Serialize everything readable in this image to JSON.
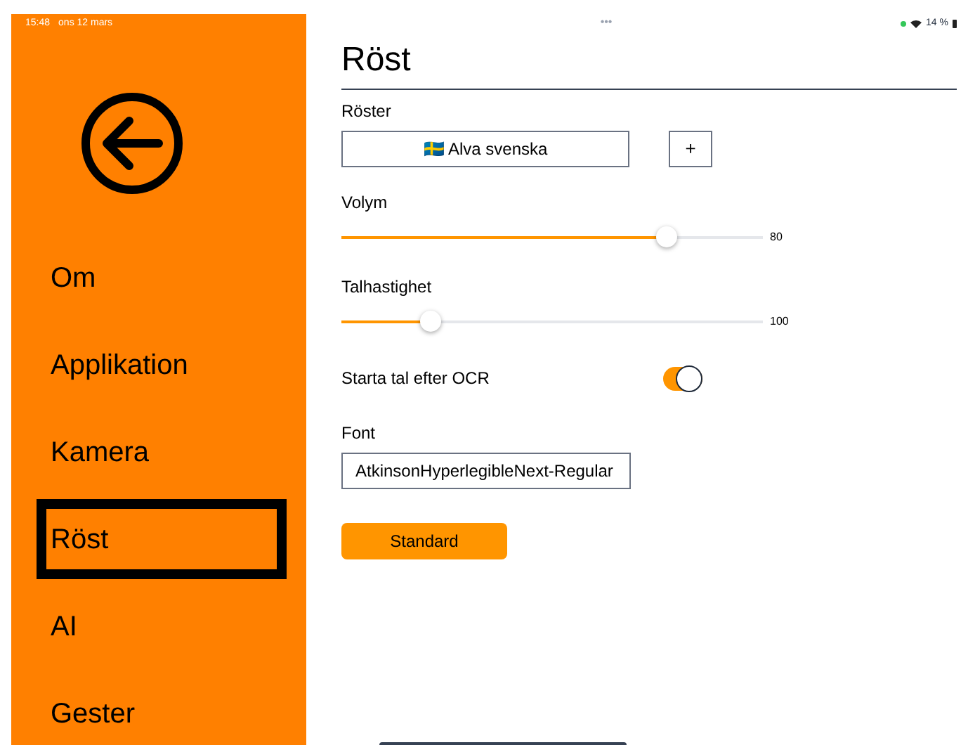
{
  "status_bar": {
    "time": "15:48",
    "date": "ons 12 mars",
    "dots": "•••",
    "battery": "14 %"
  },
  "sidebar": {
    "items": [
      {
        "label": "Om",
        "selected": false
      },
      {
        "label": "Applikation",
        "selected": false
      },
      {
        "label": "Kamera",
        "selected": false
      },
      {
        "label": "Röst",
        "selected": true
      },
      {
        "label": "AI",
        "selected": false
      },
      {
        "label": "Gester",
        "selected": false
      }
    ]
  },
  "page": {
    "title": "Röst",
    "voices": {
      "label": "Röster",
      "value": "🇸🇪 Alva svenska",
      "add": "+"
    },
    "sliders": [
      {
        "label": "Volym",
        "level": 0.77,
        "reading": "80"
      },
      {
        "label": "Talhastighet",
        "level": 0.21,
        "reading": "100"
      }
    ],
    "toggle": {
      "label": "Starta tal efter OCR",
      "on": true
    },
    "font": {
      "label": "Font",
      "value": "AtkinsonHyperlegibleNext-Regular"
    },
    "reset_button": "Standard"
  }
}
